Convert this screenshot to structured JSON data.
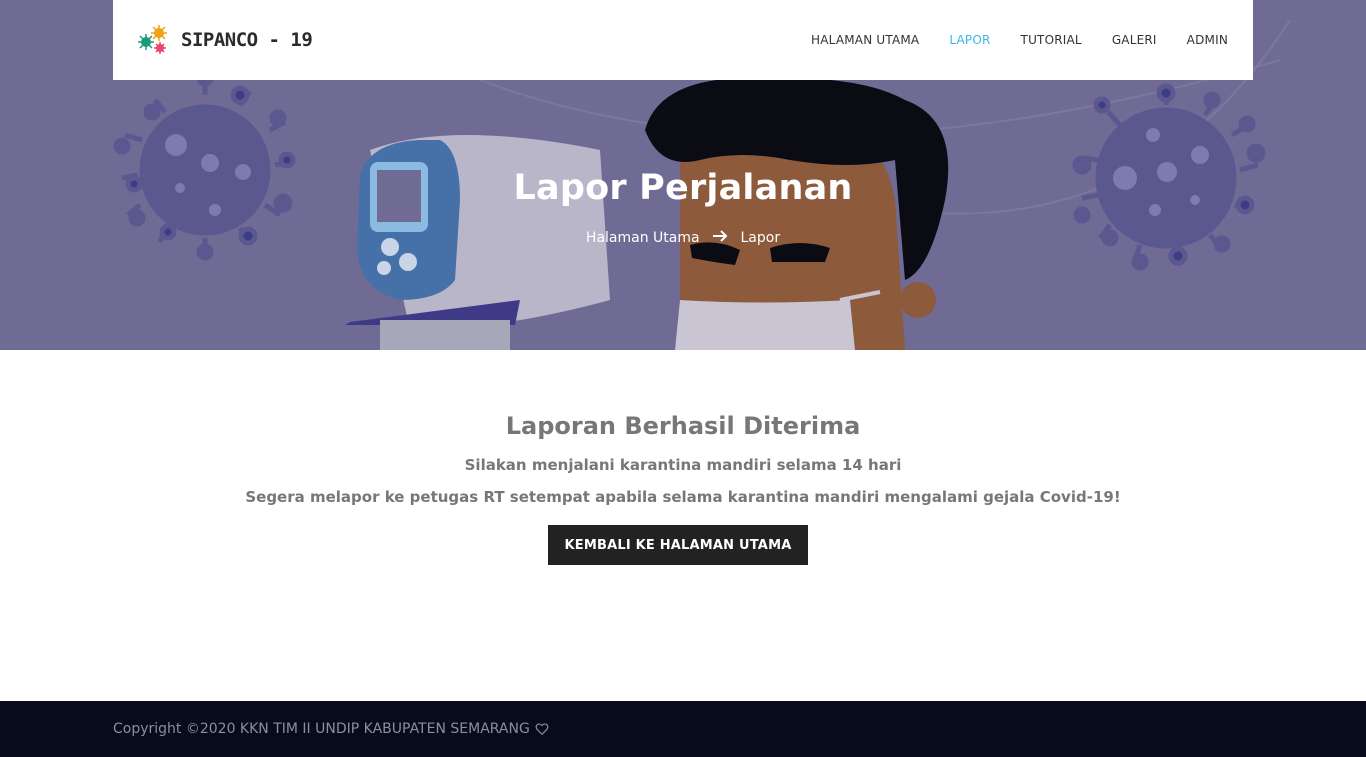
{
  "brand": {
    "name": "SIPANCO - 19",
    "icon": "virus-logo-icon"
  },
  "nav": {
    "items": [
      {
        "label": "HALAMAN UTAMA",
        "active": false
      },
      {
        "label": "LAPOR",
        "active": true
      },
      {
        "label": "TUTORIAL",
        "active": false
      },
      {
        "label": "GALERI",
        "active": false
      },
      {
        "label": "ADMIN",
        "active": false
      }
    ]
  },
  "hero": {
    "title": "Lapor Perjalanan",
    "breadcrumb": {
      "home": "Halaman Utama",
      "separator_icon": "arrow-right-icon",
      "current": "Lapor"
    }
  },
  "result": {
    "title": "Laporan Berhasil Diterima",
    "line1": "Silakan menjalani karantina mandiri selama 14 hari",
    "line2": "Segera melapor ke petugas RT setempat apabila selama karantina mandiri mengalami gejala Covid-19!",
    "button_label": "KEMBALI KE HALAMAN UTAMA"
  },
  "footer": {
    "copyright": "Copyright ©2020 KKN TIM II UNDIP KABUPATEN SEMARANG",
    "icon": "heart-icon"
  },
  "colors": {
    "hero_bg": "#6f6b95",
    "nav_active": "#3fb6e8",
    "button_bg": "#222222",
    "footer_bg": "#070b1c",
    "text_gray": "#777777"
  }
}
